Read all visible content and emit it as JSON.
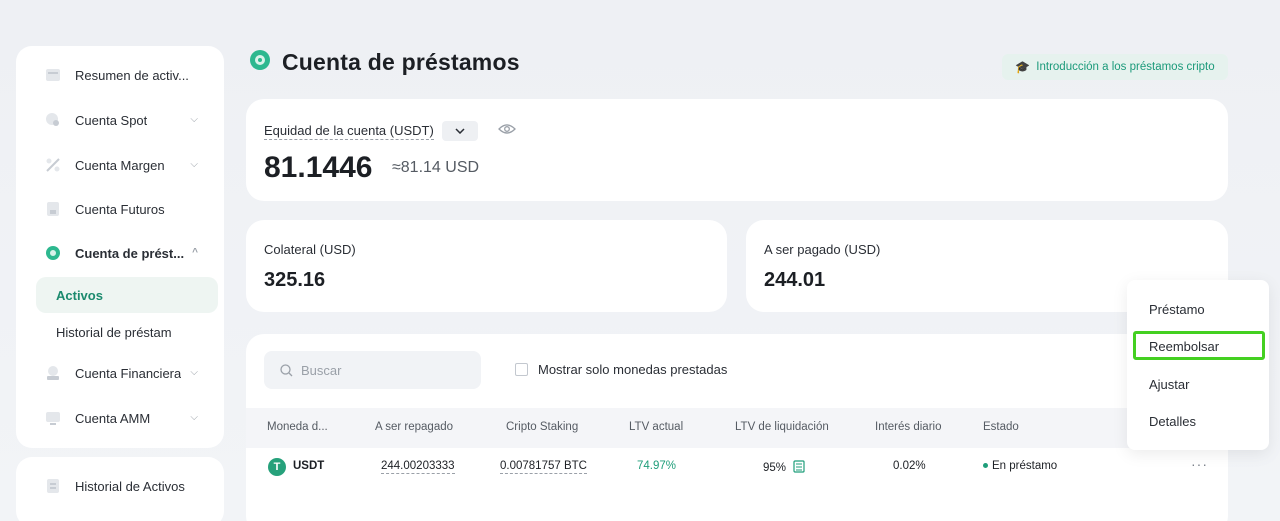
{
  "sidebar": {
    "items": [
      {
        "label": "Resumen de activ...",
        "icon": "wallet-icon",
        "chevron": false
      },
      {
        "label": "Cuenta Spot",
        "icon": "spot-icon",
        "chevron": true
      },
      {
        "label": "Cuenta Margen",
        "icon": "margin-icon",
        "chevron": true
      },
      {
        "label": "Cuenta Futuros",
        "icon": "futures-icon",
        "chevron": false
      },
      {
        "label": "Cuenta de prést...",
        "icon": "loan-icon",
        "chevron": true,
        "expanded": true
      },
      {
        "label": "Cuenta Financiera",
        "icon": "finance-icon",
        "chevron": true
      },
      {
        "label": "Cuenta AMM",
        "icon": "amm-icon",
        "chevron": true
      }
    ],
    "sub_items": [
      {
        "label": "Activos",
        "active": true
      },
      {
        "label": "Historial de préstam",
        "active": false
      }
    ],
    "bottom_item": {
      "label": "Historial de Activos",
      "icon": "history-icon"
    }
  },
  "header": {
    "title": "Cuenta de préstamos",
    "intro_link": "Introducción a los préstamos cripto"
  },
  "equity": {
    "label": "Equidad de la cuenta (USDT)",
    "value": "81.1446",
    "usd": "≈81.14 USD"
  },
  "collateral": {
    "label": "Colateral (USD)",
    "value": "325.16"
  },
  "to_repay": {
    "label": "A ser pagado (USD)",
    "value": "244.01"
  },
  "table": {
    "search_placeholder": "Buscar",
    "checkbox_label": "Mostrar solo monedas prestadas",
    "headers": [
      "Moneda d...",
      "A ser repagado",
      "Cripto Staking",
      "LTV actual",
      "LTV de liquidación",
      "Interés diario",
      "Estado"
    ],
    "row": {
      "coin": "USDT",
      "coin_letter": "T",
      "to_repay": "244.00203333",
      "staking": "0.00781757 BTC",
      "ltv_current": "74.97%",
      "ltv_liquidation": "95%",
      "daily_interest": "0.02%",
      "status": "En préstamo",
      "more": "···"
    }
  },
  "popup_menu": {
    "items": [
      "Préstamo",
      "Reembolsar",
      "Ajustar",
      "Detalles"
    ],
    "highlighted": "Reembolsar"
  },
  "colors": {
    "accent": "#1b9a7a",
    "highlight": "#44d021",
    "tether": "#26a17b"
  }
}
